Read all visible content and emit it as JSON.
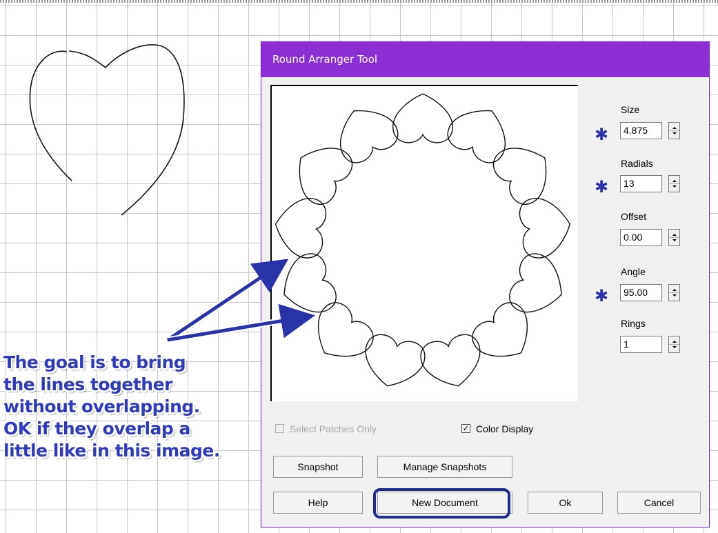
{
  "dialog": {
    "title": "Round Arranger Tool",
    "fields": {
      "size": {
        "label": "Size",
        "value": "4.875",
        "starred": true
      },
      "radials": {
        "label": "Radials",
        "value": "13",
        "starred": true
      },
      "offset": {
        "label": "Offset",
        "value": "0.00",
        "starred": false
      },
      "angle": {
        "label": "Angle",
        "value": "95.00",
        "starred": true
      },
      "rings": {
        "label": "Rings",
        "value": "1",
        "starred": false
      }
    },
    "star_symbol": "✱",
    "checkboxes": {
      "select_patches_only": {
        "label": "Select Patches Only",
        "checked": false,
        "enabled": false
      },
      "color_display": {
        "label": "Color Display",
        "checked": true,
        "enabled": true
      }
    },
    "buttons": {
      "snapshot": "Snapshot",
      "manage_snapshots": "Manage Snapshots",
      "help": "Help",
      "new_document": "New Document",
      "ok": "Ok",
      "cancel": "Cancel"
    },
    "preview": {
      "radial_count": 13
    }
  },
  "annotation": {
    "lines": [
      "The goal is to bring",
      "the lines together",
      "without overlapping.",
      "OK if they overlap a",
      "little like in this image."
    ],
    "color": "#2e3bbd",
    "highlight_color": "#1f2c8c"
  },
  "colors": {
    "titlebar": "#8b2fd4",
    "dialog_bg": "#f0f0f0"
  }
}
